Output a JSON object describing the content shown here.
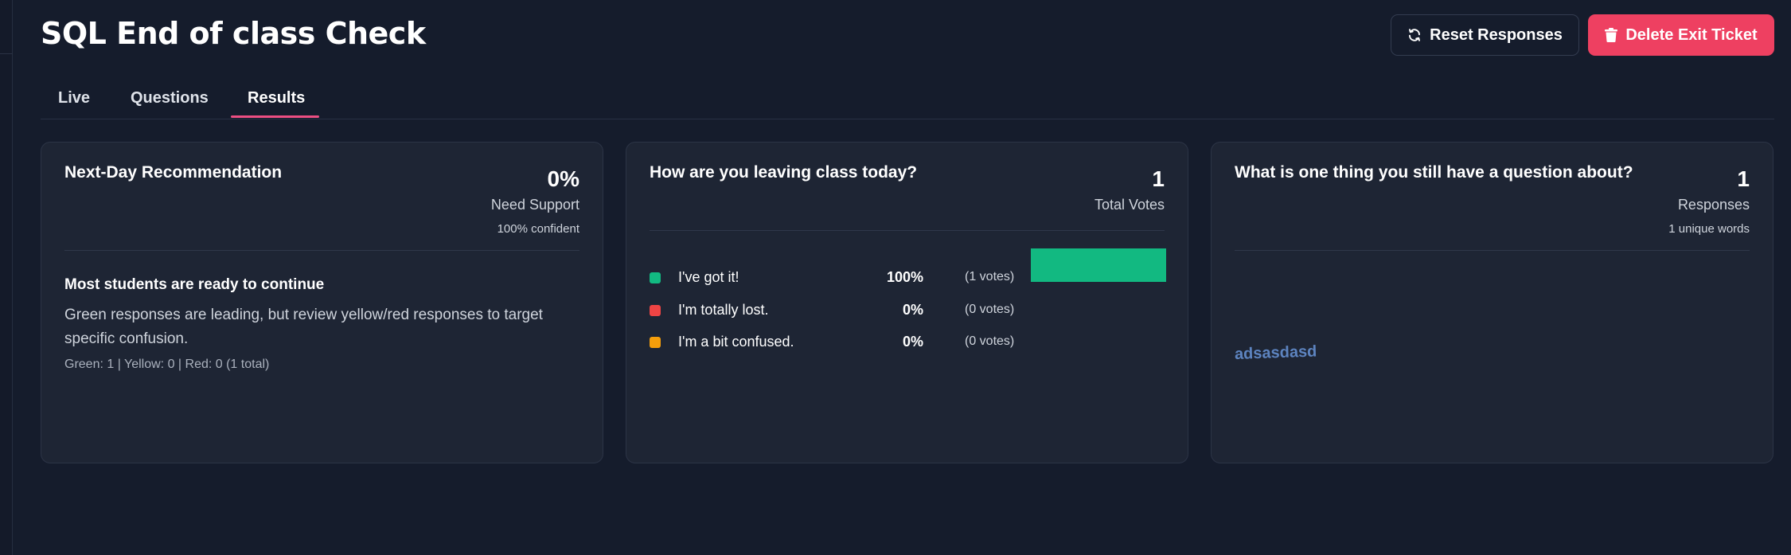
{
  "header": {
    "title": "SQL End of class Check",
    "reset_label": "Reset Responses",
    "delete_label": "Delete Exit Ticket"
  },
  "tabs": [
    {
      "label": "Live",
      "active": false
    },
    {
      "label": "Questions",
      "active": false
    },
    {
      "label": "Results",
      "active": true
    }
  ],
  "recommendation": {
    "title": "Next-Day Recommendation",
    "value": "0%",
    "value_label": "Need Support",
    "confidence": "100% confident",
    "heading": "Most students are ready to continue",
    "body": "Green responses are leading, but review yellow/red responses to target specific confusion.",
    "counts": "Green: 1 | Yellow: 0 | Red: 0 (1 total)"
  },
  "poll": {
    "title": "How are you leaving class today?",
    "total": "1",
    "total_label": "Total Votes",
    "options": [
      {
        "label": "I've got it!",
        "pct": "100%",
        "votes": "(1 votes)",
        "color": "#12b981",
        "fraction": 1.0
      },
      {
        "label": "I'm totally lost.",
        "pct": "0%",
        "votes": "(0 votes)",
        "color": "#ef4444",
        "fraction": 0.0
      },
      {
        "label": "I'm a bit confused.",
        "pct": "0%",
        "votes": "(0 votes)",
        "color": "#f59e0b",
        "fraction": 0.0
      }
    ]
  },
  "open_question": {
    "title": "What is one thing you still have a question about?",
    "total": "1",
    "total_label": "Responses",
    "unique": "1 unique words",
    "words": [
      "adsasdasd"
    ]
  },
  "colors": {
    "accent_pink": "#ec4f83",
    "delete_red": "#ee4061",
    "background": "#151c2c",
    "card": "#1e2534",
    "word_blue": "#5d84c0"
  },
  "icons": {
    "reset": "refresh-icon",
    "delete": "trash-icon"
  }
}
